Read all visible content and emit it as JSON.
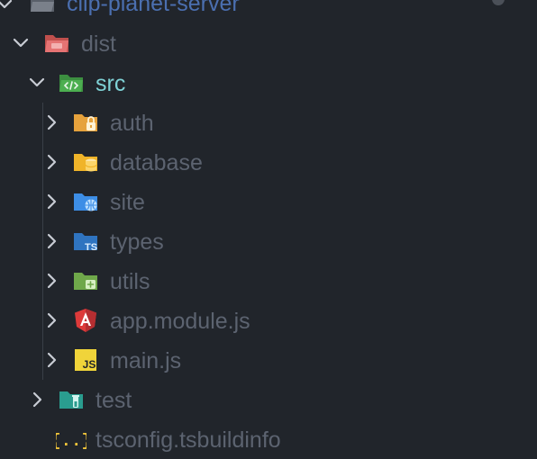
{
  "explorer": {
    "root_label": "clip-planet-server",
    "items": [
      {
        "label": "dist",
        "icon": "folder-dist-icon",
        "expanded": true
      },
      {
        "label": "src",
        "icon": "folder-src-icon",
        "expanded": true
      },
      {
        "label": "auth",
        "icon": "folder-auth-icon",
        "expanded": false
      },
      {
        "label": "database",
        "icon": "folder-database-icon",
        "expanded": false
      },
      {
        "label": "site",
        "icon": "folder-site-icon",
        "expanded": false
      },
      {
        "label": "types",
        "icon": "folder-types-icon",
        "expanded": false
      },
      {
        "label": "utils",
        "icon": "folder-utils-icon",
        "expanded": false
      },
      {
        "label": "app.module.js",
        "icon": "angular-file-icon",
        "expanded": false
      },
      {
        "label": "main.js",
        "icon": "javascript-file-icon",
        "expanded": false
      },
      {
        "label": "test",
        "icon": "folder-test-icon",
        "expanded": false
      },
      {
        "label": "tsconfig.tsbuildinfo",
        "icon": "json-file-icon"
      }
    ]
  },
  "colors": {
    "background": "#21252b",
    "text_dim": "#5c6370",
    "text_active": "#7fd2d6",
    "root_text": "#4b6fb0"
  }
}
